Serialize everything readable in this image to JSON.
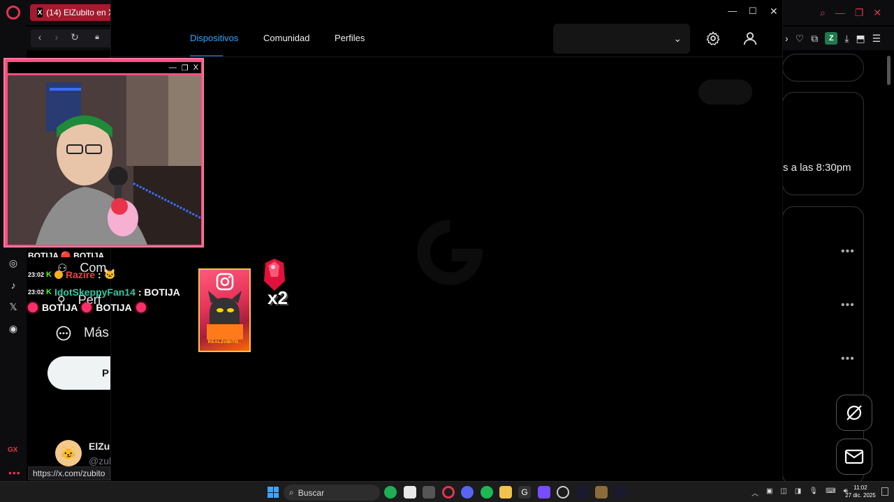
{
  "browser": {
    "tab_title": "(14) ElZubito en X",
    "status_url": "https://x.com/zubito",
    "side_label": "GX",
    "ext_badge": "Z"
  },
  "ghub": {
    "tabs": [
      {
        "label": "Dispositivos",
        "active": true
      },
      {
        "label": "Comunidad",
        "active": false
      },
      {
        "label": "Perfiles",
        "active": false
      }
    ],
    "accent_color": "#33a6ff"
  },
  "x_page": {
    "left_nav": {
      "community_label": "Com",
      "profile_label": "Perf",
      "more_label": "Más",
      "post_button": "P"
    },
    "right_text": "s a las 8:30pm",
    "user": {
      "name": "ElZub",
      "handle": "@zub"
    }
  },
  "chat": {
    "messages": [
      {
        "time": "23:02",
        "badge": "K",
        "user": "Razire",
        "text": ":"
      },
      {
        "time": "23:02",
        "badge": "K",
        "user": "IdotSkeppyFan14",
        "text": ": BOTIJA"
      }
    ],
    "line2_words": [
      "BOTIJA",
      "BOTIJA"
    ]
  },
  "overlay": {
    "insta_handle": "REALZUBITO_",
    "multiplier": "x2"
  },
  "taskbar": {
    "search_placeholder": "Buscar",
    "time": "11:02",
    "date": "27 dic. 2025"
  }
}
